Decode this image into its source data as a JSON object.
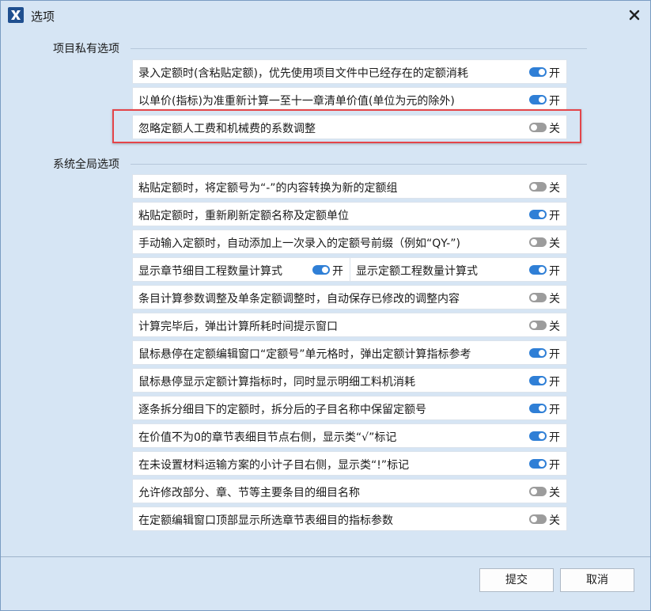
{
  "window": {
    "title": "选项"
  },
  "sections": {
    "private": "项目私有选项",
    "global": "系统全局选项"
  },
  "toggle_text": {
    "on": "开",
    "off": "关"
  },
  "colors": {
    "toggle_on": "#2f7fd6",
    "toggle_off": "#9c9c9c",
    "highlight": "#e4454a"
  },
  "private_options": [
    {
      "label": "录入定额时(含粘贴定额)，优先使用项目文件中已经存在的定额消耗",
      "on": true
    },
    {
      "label": "以单价(指标)为准重新计算一至十一章清单价值(单位为元的除外)",
      "on": true
    },
    {
      "label": "忽略定额人工费和机械费的系数调整",
      "on": false
    }
  ],
  "global_options": [
    {
      "label": "粘贴定额时，将定额号为“-”的内容转换为新的定额组",
      "on": false
    },
    {
      "label": "粘贴定额时，重新刷新定额名称及定额单位",
      "on": true
    },
    {
      "label": "手动输入定额时，自动添加上一次录入的定额号前缀（例如“QY-”)",
      "on": false
    },
    {
      "split": true,
      "left": {
        "label": "显示章节细目工程数量计算式",
        "on": true
      },
      "right": {
        "label": "显示定额工程数量计算式",
        "on": true
      }
    },
    {
      "label": "条目计算参数调整及单条定额调整时，自动保存已修改的调整内容",
      "on": false
    },
    {
      "label": "计算完毕后，弹出计算所耗时间提示窗口",
      "on": false
    },
    {
      "label": "鼠标悬停在定额编辑窗口“定额号”单元格时，弹出定额计算指标参考",
      "on": true
    },
    {
      "label": "鼠标悬停显示定额计算指标时，同时显示明细工料机消耗",
      "on": true
    },
    {
      "label": "逐条拆分细目下的定额时，拆分后的子目名称中保留定额号",
      "on": true
    },
    {
      "label": "在价值不为0的章节表细目节点右侧，显示类“√”标记",
      "on": true
    },
    {
      "label": "在未设置材料运输方案的小计子目右侧，显示类“!”标记",
      "on": true
    },
    {
      "label": "允许修改部分、章、节等主要条目的细目名称",
      "on": false
    },
    {
      "label": "在定额编辑窗口顶部显示所选章节表细目的指标参数",
      "on": false
    }
  ],
  "buttons": {
    "submit": "提交",
    "cancel": "取消"
  }
}
